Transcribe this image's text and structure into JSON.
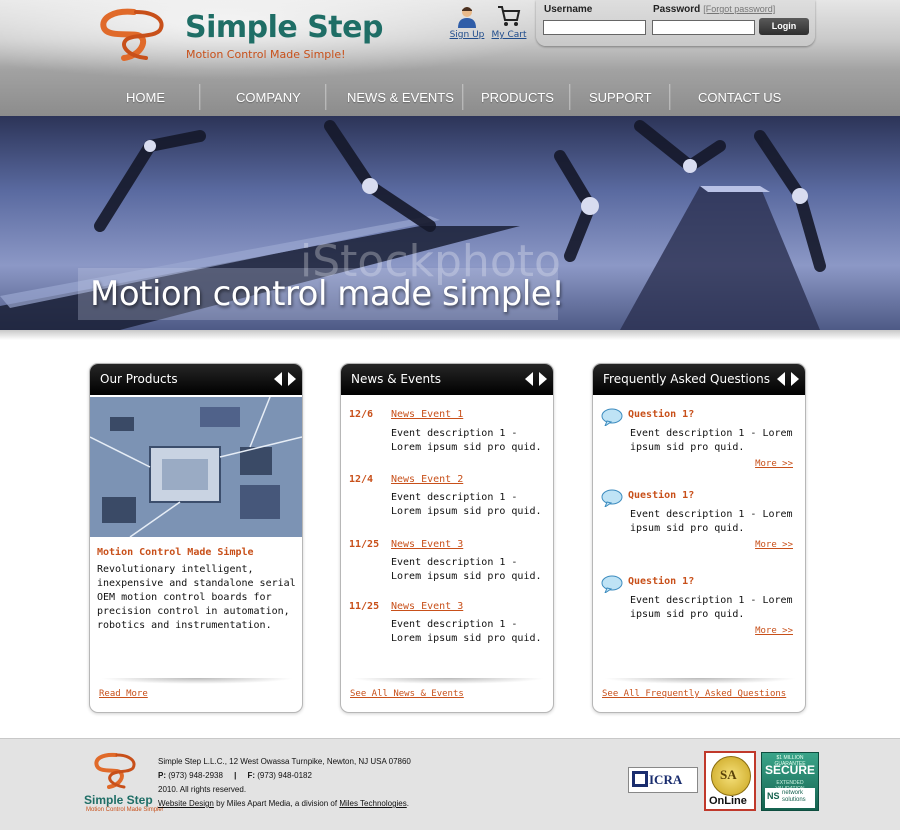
{
  "header": {
    "logo_name": "Simple Step",
    "logo_tagline": "Motion Control Made Simple!",
    "signup_label": "Sign Up",
    "cart_label": "My Cart"
  },
  "login": {
    "username_label": "Username",
    "password_label": "Password",
    "forgot_label": "[Forgot password]",
    "username_value": "",
    "password_value": "",
    "button_label": "Login"
  },
  "nav": {
    "items": [
      "HOME",
      "COMPANY",
      "NEWS & EVENTS",
      "PRODUCTS",
      "SUPPORT",
      "CONTACT US"
    ]
  },
  "hero": {
    "headline": "Motion control made simple!",
    "watermark": "iStockphoto"
  },
  "products": {
    "title": "Our Products",
    "item_title": "Motion Control Made Simple",
    "item_desc": "Revolutionary intelligent, inexpensive and standalone serial OEM motion control boards for precision control in automation, robotics and instrumentation.",
    "footer_link": "Read More"
  },
  "news": {
    "title": "News & Events",
    "items": [
      {
        "date": "12/6",
        "title": "News Event 1",
        "desc": "Event description 1 - Lorem ipsum sid pro quid."
      },
      {
        "date": "12/4",
        "title": "News Event 2",
        "desc": "Event description 1 - Lorem ipsum sid pro quid."
      },
      {
        "date": "11/25",
        "title": "News Event 3",
        "desc": "Event description 1 - Lorem ipsum sid pro quid."
      },
      {
        "date": "11/25",
        "title": "News Event 3",
        "desc": "Event description 1 - Lorem ipsum sid pro quid."
      }
    ],
    "footer_link": "See All News & Events"
  },
  "faq": {
    "title": "Frequently Asked Questions",
    "items": [
      {
        "question": "Question 1?",
        "desc": "Event description 1 - Lorem ipsum sid pro quid.",
        "more": "More >>"
      },
      {
        "question": "Question 1?",
        "desc": "Event description 1 - Lorem ipsum sid pro quid.",
        "more": "More >>"
      },
      {
        "question": "Question 1?",
        "desc": "Event description 1 - Lorem ipsum sid pro quid.",
        "more": "More >>"
      }
    ],
    "footer_link": "See All Frequently Asked Questions"
  },
  "footer": {
    "logo_name": "Simple Step",
    "logo_tagline": "Motion Control Made Simple!",
    "address": "Simple Step L.L.C., 12 West Owassa Turnpike, Newton, NJ USA 07860",
    "phone_label": "P:",
    "phone": "(973) 948-2938",
    "separator": "|",
    "fax_label": "F:",
    "fax": "(973) 948-0182",
    "copyright": "2010. All rights reserved.",
    "design_link": "Website Design",
    "design_by": "by Miles Apart Media, a division of",
    "company_link": "Miles Technologies",
    "company_end": ".",
    "badge_icra": "ICRA",
    "badge_sa_letters": "SA",
    "badge_sa_text": "OnLine",
    "badge_secure_top": "$1 MILLION GUARANTEE",
    "badge_secure_title": "SECURE",
    "badge_secure_sub": "EXTENDED VALIDATION",
    "badge_ns_logo": "NS",
    "badge_ns_text1": "network",
    "badge_ns_text2": "solutions"
  },
  "colors": {
    "brand_teal": "#1f6e66",
    "accent_orange": "#c8501a",
    "box_header": "#000000",
    "nav_bg": "#8c8c8c"
  },
  "icons": [
    "logo-swirl-icon",
    "user-icon",
    "cart-icon",
    "arrow-left-icon",
    "arrow-right-icon",
    "speech-bubble-icon"
  ]
}
